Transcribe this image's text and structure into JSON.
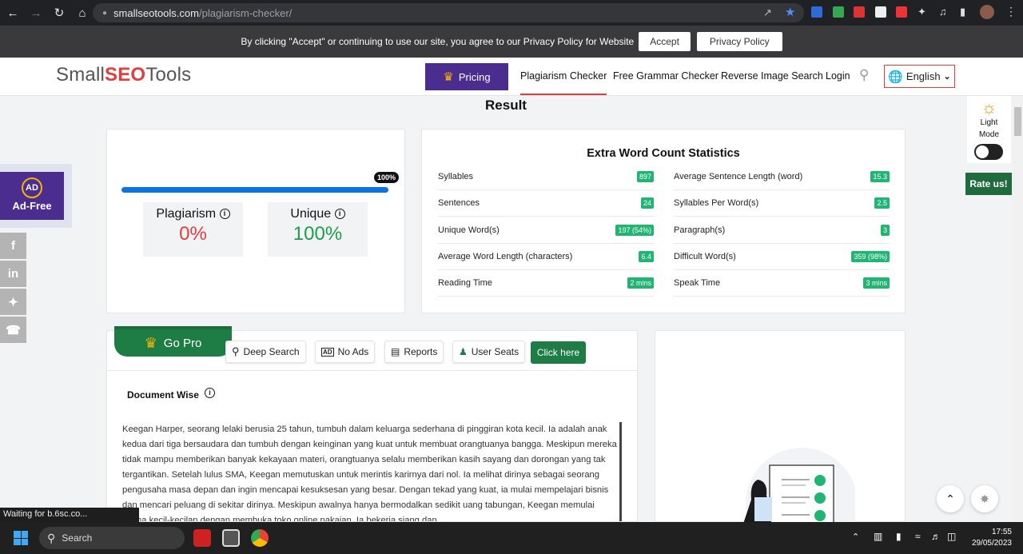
{
  "browser": {
    "url_host": "smallseotools.com",
    "url_path": "/plagiarism-checker/",
    "status_text": "Waiting for b.6sc.co..."
  },
  "cookie_banner": {
    "message": "By clicking \"Accept\" or continuing to use our site, you agree to our Privacy Policy for Website",
    "accept_label": "Accept",
    "privacy_label": "Privacy Policy"
  },
  "header": {
    "logo_small": "Small",
    "logo_seo": "SEO",
    "logo_tools": "Tools",
    "pricing_label": "Pricing",
    "nav": [
      "Plagiarism Checker",
      "Free Grammar Checker",
      "Reverse Image Search",
      "Login"
    ],
    "language": "English"
  },
  "result": {
    "title": "Result",
    "progress_label": "100%",
    "progress_fraction": 1.0,
    "plagiarism_label": "Plagiarism",
    "plagiarism_value": "0%",
    "unique_label": "Unique",
    "unique_value": "100%"
  },
  "word_stats": {
    "title": "Extra Word Count Statistics",
    "left": [
      {
        "label": "Syllables",
        "value": "897"
      },
      {
        "label": "Sentences",
        "value": "24"
      },
      {
        "label": "Unique Word(s)",
        "value": "197 (54%)"
      },
      {
        "label": "Average Word Length (characters)",
        "value": "6.4"
      },
      {
        "label": "Reading Time",
        "value": "2 mins"
      }
    ],
    "right": [
      {
        "label": "Average Sentence Length (word)",
        "value": "15.3"
      },
      {
        "label": "Syllables Per Word(s)",
        "value": "2.5"
      },
      {
        "label": "Paragraph(s)",
        "value": "3"
      },
      {
        "label": "Difficult Word(s)",
        "value": "359 (98%)"
      },
      {
        "label": "Speak Time",
        "value": "3 mins"
      }
    ]
  },
  "sidebar": {
    "ad_free_label": "Ad-Free",
    "ad_icon_text": "AD",
    "rate_label": "Rate us!",
    "light_mode_line1": "Light",
    "light_mode_line2": "Mode"
  },
  "gopro": {
    "label": "Go Pro",
    "features": [
      "Deep Search",
      "No Ads",
      "Reports",
      "User Seats"
    ],
    "click_label": "Click here"
  },
  "document": {
    "heading": "Document Wise",
    "text": "Keegan Harper, seorang lelaki berusia 25 tahun, tumbuh dalam keluarga sederhana di pinggiran kota kecil. Ia adalah anak kedua dari tiga bersaudara dan tumbuh dengan keinginan yang kuat untuk membuat orangtuanya bangga. Meskipun mereka tidak mampu memberikan banyak kekayaan materi, orangtuanya selalu memberikan kasih sayang dan dorongan yang tak tergantikan. Setelah lulus SMA, Keegan memutuskan untuk merintis karirnya dari nol. Ia melihat dirinya sebagai seorang pengusaha masa depan dan ingin mencapai kesuksesan yang besar. Dengan tekad yang kuat, ia mulai mempelajari bisnis dan mencari peluang di sekitar dirinya. Meskipun awalnya hanya bermodalkan sedikit uang tabungan, Keegan memulai usaha kecil-kecilan dengan membuka toko online pakaian. Ia bekerja siang dan"
  },
  "taskbar": {
    "search_label": "Search",
    "time": "17:55",
    "date": "29/05/2023"
  }
}
